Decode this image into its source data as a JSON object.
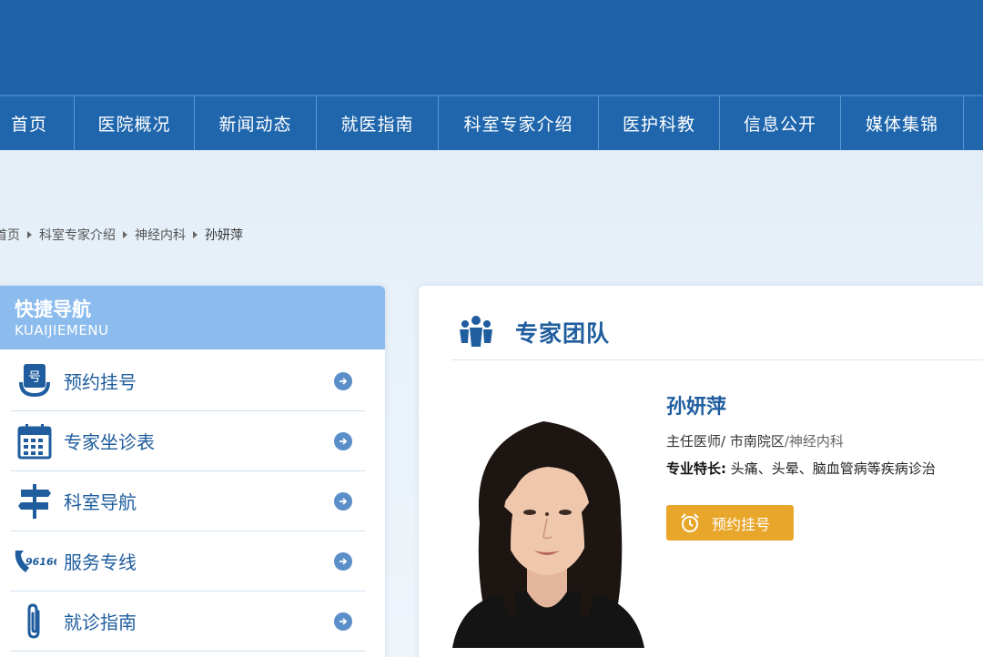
{
  "nav": {
    "items": [
      {
        "label": "首页"
      },
      {
        "label": "医院概况"
      },
      {
        "label": "新闻动态"
      },
      {
        "label": "就医指南"
      },
      {
        "label": "科室专家介绍"
      },
      {
        "label": "医护科教"
      },
      {
        "label": "信息公开"
      },
      {
        "label": "媒体集锦"
      },
      {
        "label": ""
      }
    ]
  },
  "breadcrumb": {
    "items": [
      "首页",
      "科室专家介绍",
      "神经内科",
      "孙妍萍"
    ]
  },
  "sidebar": {
    "title": "快捷导航",
    "subtitle": "KUAIJIEMENU",
    "items": [
      {
        "label": "预约挂号",
        "icon": "registration-icon"
      },
      {
        "label": "专家坐诊表",
        "icon": "calendar-icon"
      },
      {
        "label": "科室导航",
        "icon": "signpost-icon"
      },
      {
        "label": "服务专线",
        "icon": "phone-96166-icon",
        "icon_text": "96166"
      },
      {
        "label": "就诊指南",
        "icon": "paperclip-icon"
      }
    ]
  },
  "main": {
    "section_title": "专家团队",
    "doctor": {
      "name": "孙妍萍",
      "title_campus": "主任医师/ 市南院区",
      "department": "/神经内科",
      "specialty_label": "专业特长:",
      "specialty_value": " 头痛、头晕、脑血管病等疾病诊治"
    },
    "book_button": "预约挂号"
  },
  "colors": {
    "nav_bg": "#1f66ad",
    "accent_blue": "#1f5d9e",
    "sidebar_header": "#8cbcee",
    "book_button": "#e8a62a"
  }
}
